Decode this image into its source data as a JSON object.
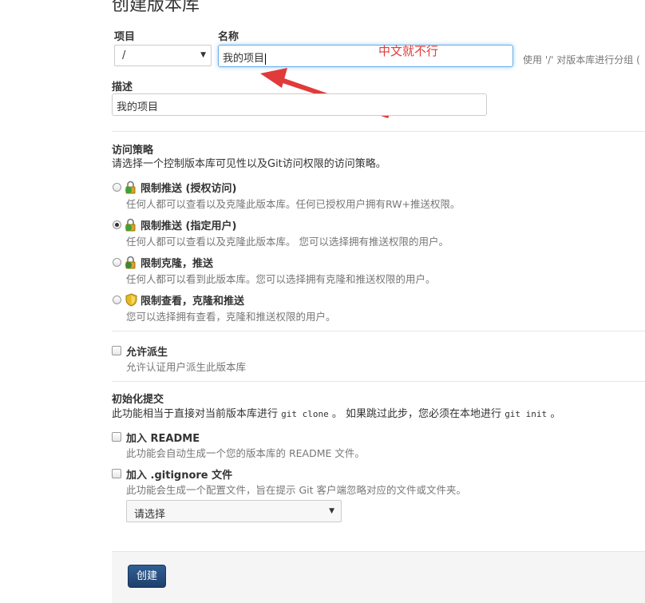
{
  "page": {
    "title": "创建版本库"
  },
  "form": {
    "project_label": "项目",
    "project_value": "/",
    "name_label": "名称",
    "name_value": "我的项目",
    "name_hint": "使用 '/' 对版本库进行分组 (",
    "description_label": "描述",
    "description_value": "我的项目"
  },
  "annotation": {
    "text": "中文就不行",
    "color": "#e03a3a"
  },
  "access": {
    "title": "访问策略",
    "description": "请选择一个控制版本库可见性以及Git访问权限的访问策略。",
    "options": [
      {
        "title": "限制推送 (授权访问)",
        "desc": "任何人都可以查看以及克隆此版本库。任何已授权用户拥有RW+推送权限。",
        "icon": "lock-green-icon",
        "selected": false
      },
      {
        "title": "限制推送 (指定用户)",
        "desc": "任何人都可以查看以及克隆此版本库。 您可以选择拥有推送权限的用户。",
        "icon": "lock-green-icon",
        "selected": true
      },
      {
        "title": "限制克隆，推送",
        "desc": "任何人都可以看到此版本库。您可以选择拥有克隆和推送权限的用户。",
        "icon": "lock-blue-icon",
        "selected": false
      },
      {
        "title": "限制查看，克隆和推送",
        "desc": "您可以选择拥有查看，克隆和推送权限的用户。",
        "icon": "shield-icon",
        "selected": false
      }
    ]
  },
  "fork": {
    "title": "允许派生",
    "desc": "允许认证用户派生此版本库"
  },
  "init": {
    "title": "初始化提交",
    "desc_part1": "此功能相当于直接对当前版本库进行",
    "cmd_clone": "git clone",
    "desc_part2": "。 如果跳过此步，您必须在本地进行",
    "cmd_init": "git init",
    "desc_part3": "。",
    "readme_title": "加入 README",
    "readme_desc": "此功能会自动生成一个您的版本库的 README 文件。",
    "gitignore_title": "加入 .gitignore 文件",
    "gitignore_desc": "此功能会生成一个配置文件，旨在提示 Git 客户端忽略对应的文件或文件夹。",
    "gitignore_select": "请选择"
  },
  "footer": {
    "create_label": "创建",
    "create_color": "#2a5286"
  }
}
